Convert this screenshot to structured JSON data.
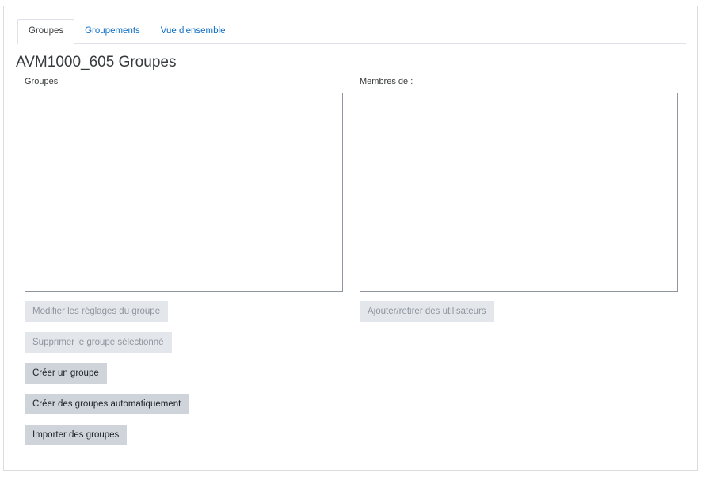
{
  "tabs": [
    {
      "label": "Groupes",
      "active": true
    },
    {
      "label": "Groupements",
      "active": false
    },
    {
      "label": "Vue d'ensemble",
      "active": false
    }
  ],
  "page": {
    "title": "AVM1000_605 Groupes"
  },
  "groups_panel": {
    "label": "Groupes",
    "buttons": {
      "edit": "Modifier les réglages du groupe",
      "delete": "Supprimer le groupe sélectionné",
      "create": "Créer un groupe",
      "auto_create": "Créer des groupes automatiquement",
      "import": "Importer des groupes"
    }
  },
  "members_panel": {
    "label": "Membres de :",
    "buttons": {
      "add_remove": "Ajouter/retirer des utilisateurs"
    }
  }
}
